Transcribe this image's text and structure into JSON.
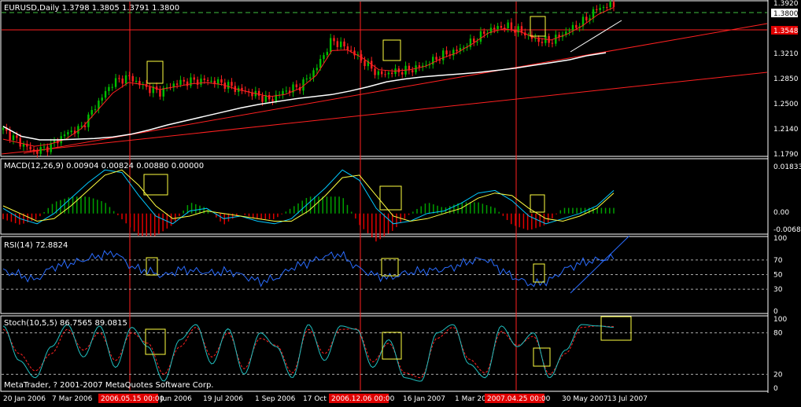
{
  "chart_data": {
    "type": "line",
    "symbol_header": "EURUSD,Daily  1.3798 1.3805 1.3791 1.3800",
    "copyright": "MetaTrader, ? 2001-2007 MetaQuotes Software Corp.",
    "price_axis": {
      "ticks": [
        "1.3920",
        "1.3210",
        "1.2850",
        "1.2500",
        "1.2140",
        "1.1790"
      ],
      "current": "1.3800",
      "line_tag": "1.3548",
      "ylim": [
        1.179,
        1.392
      ]
    },
    "date_axis": [
      "20 Jan 2006",
      "7 Mar 2006",
      "Jun 2006",
      "19 Jul 2006",
      "1 Sep 2006",
      "17 Oct 2",
      "6",
      "16 Jan 2007",
      "1 Mar 20",
      "30 May 2007",
      "13 Jul 2007"
    ],
    "highlighted_dates": [
      "2006.05.15 00:00",
      "2006.12.06 00:00",
      "2007.04.25 00:00"
    ],
    "close_series": [
      1.213,
      1.196,
      1.182,
      1.19,
      1.208,
      1.216,
      1.25,
      1.28,
      1.288,
      1.274,
      1.266,
      1.279,
      1.282,
      1.283,
      1.279,
      1.27,
      1.264,
      1.255,
      1.268,
      1.275,
      1.3,
      1.34,
      1.328,
      1.31,
      1.291,
      1.295,
      1.298,
      1.305,
      1.318,
      1.325,
      1.338,
      1.354,
      1.36,
      1.353,
      1.34,
      1.338,
      1.352,
      1.365,
      1.385,
      1.39
    ],
    "moving_averages": {
      "ma_red": [
        1.2,
        1.195,
        1.19,
        1.193,
        1.2,
        1.215,
        1.24,
        1.265,
        1.28,
        1.277,
        1.27,
        1.274,
        1.278,
        1.28,
        1.277,
        1.27,
        1.265,
        1.26,
        1.263,
        1.272,
        1.29,
        1.325,
        1.326,
        1.314,
        1.298,
        1.296,
        1.298,
        1.303,
        1.314,
        1.322,
        1.335,
        1.35,
        1.356,
        1.352,
        1.343,
        1.34,
        1.348,
        1.36,
        1.376,
        1.386
      ],
      "ma_white": [
        1.218,
        1.204,
        1.199,
        1.199,
        1.2,
        1.201,
        1.203,
        1.207,
        1.213,
        1.22,
        1.226,
        1.232,
        1.238,
        1.244,
        1.249,
        1.253,
        1.257,
        1.26,
        1.263,
        1.268,
        1.274,
        1.281,
        1.285,
        1.288,
        1.29,
        1.292,
        1.294,
        1.297,
        1.3,
        1.304,
        1.308,
        1.312,
        1.318,
        1.322
      ]
    },
    "macd": {
      "header": "MACD(12,26,9) 0.00904 0.00824 0.00880 0.00000",
      "ticks": [
        "0.01833",
        "0.00",
        "-0.00683"
      ],
      "ylim": [
        -0.00683,
        0.01833
      ],
      "main": [
        0.002,
        -0.002,
        -0.004,
        0.0,
        0.006,
        0.012,
        0.017,
        0.016,
        0.007,
        -0.001,
        -0.004,
        0.001,
        0.002,
        -0.002,
        -0.001,
        -0.003,
        -0.004,
        -0.002,
        0.004,
        0.01,
        0.017,
        0.013,
        0.002,
        -0.004,
        -0.003,
        0.0,
        0.001,
        0.004,
        0.008,
        0.009,
        0.005,
        -0.001,
        -0.004,
        -0.002,
        0.0,
        0.003,
        0.009
      ],
      "signal": [
        0.003,
        0.0,
        -0.003,
        -0.002,
        0.003,
        0.009,
        0.015,
        0.017,
        0.011,
        0.003,
        -0.002,
        -0.001,
        0.001,
        0.0,
        -0.001,
        -0.002,
        -0.003,
        -0.003,
        0.001,
        0.007,
        0.014,
        0.015,
        0.007,
        -0.001,
        -0.003,
        -0.002,
        0.0,
        0.002,
        0.006,
        0.008,
        0.007,
        0.002,
        -0.002,
        -0.003,
        -0.001,
        0.002,
        0.008
      ]
    },
    "rsi": {
      "header": "RSI(14) 72.8824",
      "ticks": [
        "100",
        "70",
        "50",
        "30",
        "0"
      ],
      "ylim": [
        0,
        100
      ],
      "values": [
        55,
        50,
        42,
        60,
        64,
        70,
        76,
        80,
        60,
        55,
        48,
        57,
        55,
        52,
        55,
        48,
        40,
        45,
        60,
        66,
        75,
        78,
        60,
        50,
        45,
        52,
        55,
        56,
        60,
        68,
        72,
        56,
        44,
        36,
        42,
        58,
        66,
        70,
        73
      ]
    },
    "stoch": {
      "header": "Stoch(10,5,5) 86.7565 89.0815",
      "ticks": [
        "100",
        "80",
        "20",
        "0"
      ],
      "ylim": [
        0,
        100
      ],
      "main": [
        90,
        40,
        15,
        60,
        92,
        45,
        90,
        30,
        88,
        60,
        10,
        70,
        92,
        35,
        86,
        20,
        80,
        60,
        15,
        92,
        40,
        90,
        85,
        30,
        70,
        15,
        10,
        80,
        92,
        35,
        15,
        90,
        60,
        80,
        15,
        55,
        92,
        90,
        88
      ],
      "signal": [
        85,
        50,
        25,
        50,
        85,
        55,
        80,
        40,
        80,
        65,
        20,
        60,
        88,
        45,
        80,
        28,
        72,
        62,
        22,
        85,
        50,
        85,
        86,
        38,
        65,
        22,
        15,
        72,
        88,
        42,
        22,
        82,
        62,
        75,
        20,
        50,
        88,
        90,
        89
      ]
    }
  }
}
